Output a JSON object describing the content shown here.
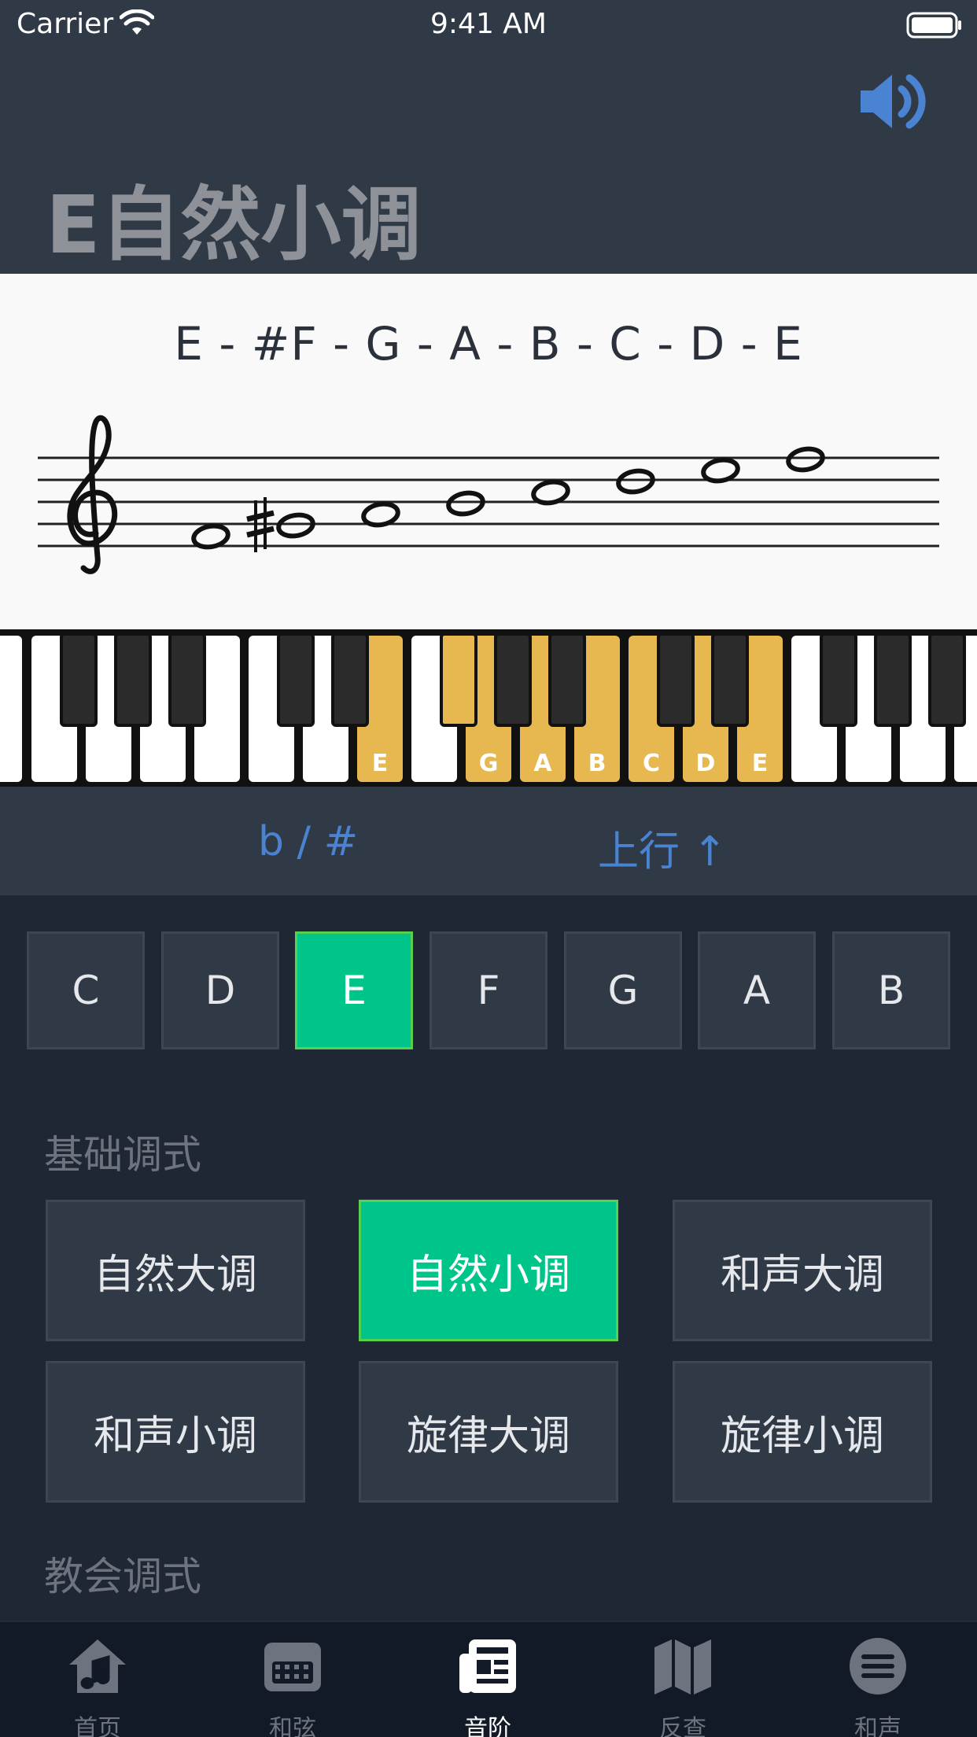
{
  "status_bar": {
    "carrier": "Carrier",
    "time": "9:41 AM"
  },
  "header": {
    "title": "E自然小调",
    "sound_icon": "speaker-icon"
  },
  "scale": {
    "notes_text": "E - #F - G - A - B - C - D - E",
    "highlighted_key_labels": [
      "E",
      "G",
      "A",
      "B",
      "C",
      "D",
      "E"
    ]
  },
  "options": {
    "accidental": "b / #",
    "direction": "上行 ↑"
  },
  "root_keys": {
    "items": [
      "C",
      "D",
      "E",
      "F",
      "G",
      "A",
      "B"
    ],
    "selected": "E"
  },
  "basic_modes": {
    "label": "基础调式",
    "items": [
      "自然大调",
      "自然小调",
      "和声大调",
      "和声小调",
      "旋律大调",
      "旋律小调"
    ],
    "selected": "自然小调"
  },
  "church_modes": {
    "label": "教会调式"
  },
  "tabbar": {
    "items": [
      {
        "label": "首页",
        "icon": "home-music-icon"
      },
      {
        "label": "和弦",
        "icon": "keyboard-icon"
      },
      {
        "label": "音阶",
        "icon": "newspaper-icon"
      },
      {
        "label": "反查",
        "icon": "map-icon"
      },
      {
        "label": "和声",
        "icon": "menu-circle-icon"
      }
    ],
    "active": "音阶"
  },
  "colors": {
    "accent_green": "#00c58b",
    "highlight_key": "#e6b84f",
    "link_blue": "#4a83d1",
    "panel": "#303a47",
    "background": "#1f2735"
  }
}
